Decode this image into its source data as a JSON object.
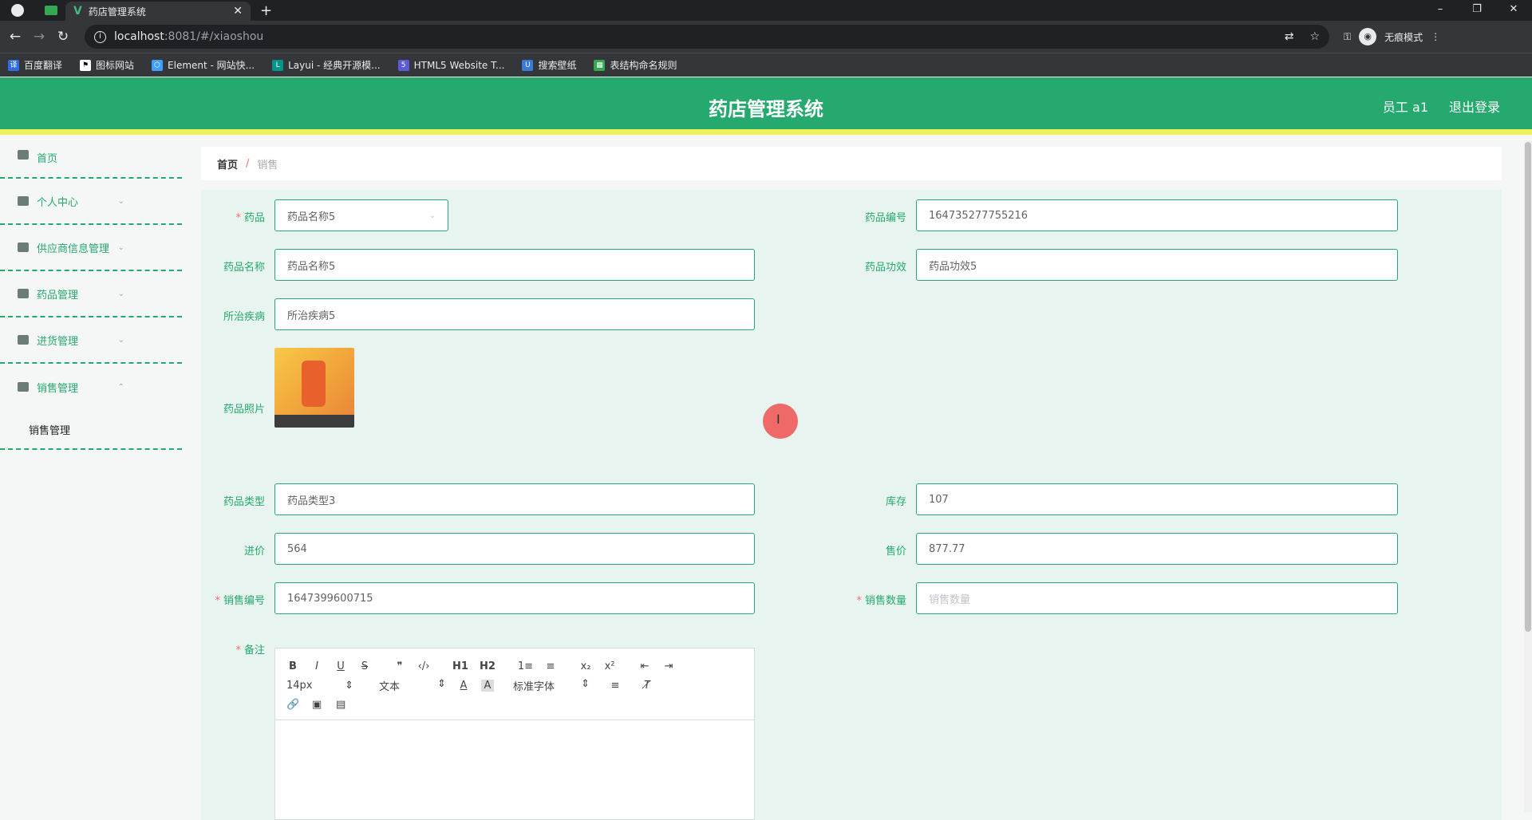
{
  "browser": {
    "tab_title": "药店管理系统",
    "url_host": "localhost",
    "url_path": ":8081/#/xiaoshou",
    "incognito_label": "无痕模式",
    "bookmarks": [
      {
        "label": "百度翻译",
        "color": "#2f6ce5"
      },
      {
        "label": "图标网站",
        "color": "#ffffff"
      },
      {
        "label": "Element - 网站快...",
        "color": "#409eff"
      },
      {
        "label": "Layui - 经典开源模...",
        "color": "#009688"
      },
      {
        "label": "HTML5 Website T...",
        "color": "#5b5bd6"
      },
      {
        "label": "搜索壁纸",
        "color": "#3a7bd5"
      },
      {
        "label": "表结构命名规则",
        "color": "#34a853"
      }
    ]
  },
  "header": {
    "title": "药店管理系统",
    "user": "员工 a1",
    "logout": "退出登录",
    "accent_color": "#26a96e"
  },
  "sidebar": {
    "items": [
      {
        "label": "首页",
        "icon": "home-icon"
      },
      {
        "label": "个人中心",
        "icon": "user-icon"
      },
      {
        "label": "供应商信息管理",
        "icon": "chart-icon"
      },
      {
        "label": "药品管理",
        "icon": "monitor-icon"
      },
      {
        "label": "进货管理",
        "icon": "list-icon"
      },
      {
        "label": "销售管理",
        "icon": "sliders-icon"
      }
    ],
    "sub_item": "销售管理"
  },
  "breadcrumb": {
    "home": "首页",
    "separator": "/",
    "current": "销售"
  },
  "form": {
    "drug": {
      "label": "药品",
      "value": "药品名称5"
    },
    "drug_code": {
      "label": "药品编号",
      "value": "164735277755216"
    },
    "drug_name": {
      "label": "药品名称",
      "value": "药品名称5"
    },
    "drug_effect": {
      "label": "药品功效",
      "value": "药品功效5"
    },
    "disease": {
      "label": "所治疾病",
      "value": "所治疾病5"
    },
    "photo": {
      "label": "药品照片"
    },
    "drug_type": {
      "label": "药品类型",
      "value": "药品类型3"
    },
    "stock": {
      "label": "库存",
      "value": "107"
    },
    "purchase_price": {
      "label": "进价",
      "value": "564"
    },
    "sale_price": {
      "label": "售价",
      "value": "877.77"
    },
    "sale_code": {
      "label": "销售编号",
      "value": "1647399600715"
    },
    "sale_qty": {
      "label": "销售数量",
      "placeholder": "销售数量"
    },
    "remark": {
      "label": "备注"
    }
  },
  "editor": {
    "font_size": "14px",
    "text_type": "文本",
    "font_family": "标准字体",
    "buttons_row1": [
      "B",
      "I",
      "U",
      "S",
      "❞",
      "‹/›",
      "H1",
      "H2",
      "1≡",
      "≡",
      "x₂",
      "x²",
      "⇤",
      "⇥"
    ]
  }
}
